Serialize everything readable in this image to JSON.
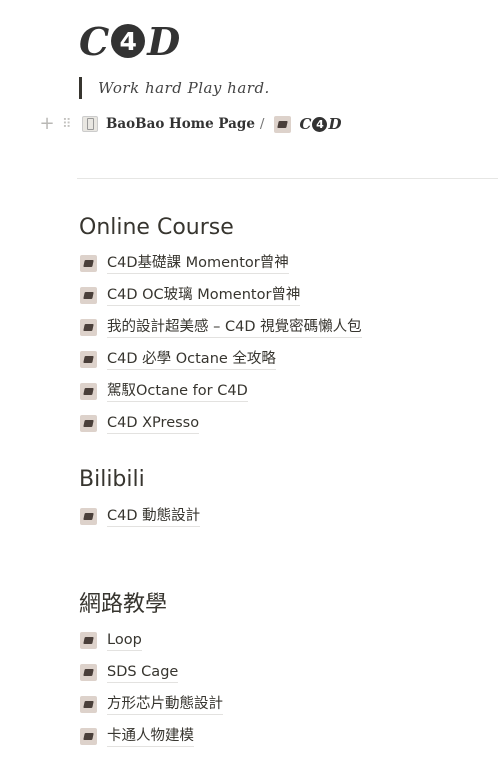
{
  "page": {
    "title_left": "C",
    "title_circle": "4",
    "title_right": "D",
    "quote": "Work hard Play hard."
  },
  "breadcrumb": {
    "home_label": "BaoBao Home Page",
    "separator": "/",
    "current_left": "C",
    "current_circle": "4",
    "current_right": "D"
  },
  "sections": {
    "online_course": {
      "heading": "Online Course",
      "items": [
        "C4D基礎課 Momentor曾神",
        "C4D OC玻璃 Momentor曾神",
        "我的設計超美感 – C4D 視覺密碼懶人包",
        "C4D 必學 Octane 全攻略",
        "駕馭Octane for C4D",
        "C4D XPresso"
      ]
    },
    "bilibili": {
      "heading": "Bilibili",
      "items": [
        "C4D 動態設計"
      ]
    },
    "web_tutorials": {
      "heading": "網路教學",
      "items": [
        "Loop",
        "SDS Cage",
        "方形芯片動態設計",
        "卡通人物建模"
      ]
    },
    "icons": {
      "add": "plus-icon",
      "drag": "drag-handle-icon",
      "home": "phone-page-icon",
      "page": "c4d-page-icon"
    }
  }
}
